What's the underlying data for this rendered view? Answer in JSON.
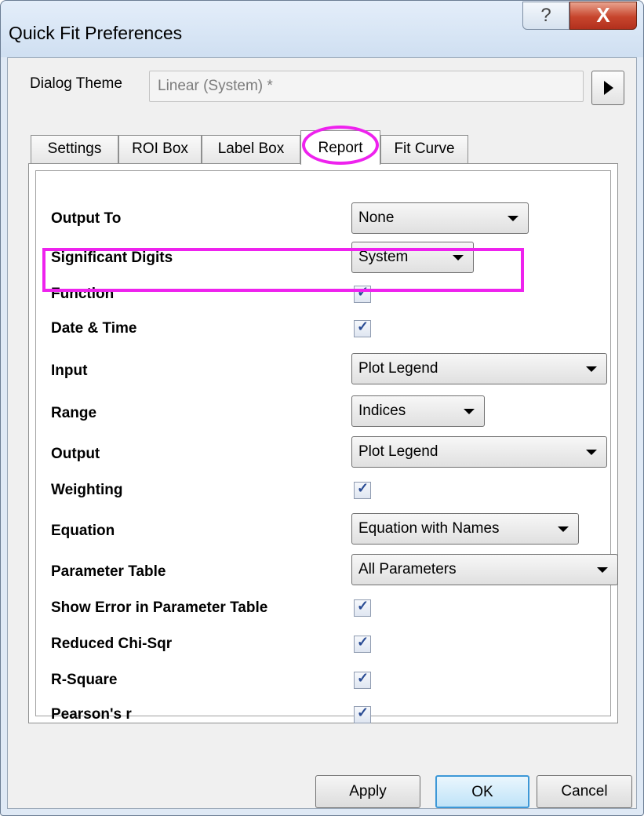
{
  "window": {
    "title": "Quick Fit Preferences",
    "help_glyph": "?",
    "close_glyph": "X"
  },
  "theme": {
    "label": "Dialog Theme",
    "value": "Linear (System) *"
  },
  "tabs": [
    {
      "label": "Settings"
    },
    {
      "label": "ROI Box"
    },
    {
      "label": "Label Box"
    },
    {
      "label": "Report"
    },
    {
      "label": "Fit Curve"
    }
  ],
  "active_tab": "Report",
  "rows": [
    {
      "label": "Output To",
      "control": "combo",
      "value": "None"
    },
    {
      "label": "Significant Digits",
      "control": "combo",
      "value": "System"
    },
    {
      "label": "Function",
      "control": "checkbox",
      "checked": true
    },
    {
      "label": "Date & Time",
      "control": "checkbox",
      "checked": true
    },
    {
      "label": "Input",
      "control": "combo",
      "value": "Plot Legend"
    },
    {
      "label": "Range",
      "control": "combo",
      "value": "Indices"
    },
    {
      "label": "Output",
      "control": "combo",
      "value": "Plot Legend"
    },
    {
      "label": "Weighting",
      "control": "checkbox",
      "checked": true
    },
    {
      "label": "Equation",
      "control": "combo",
      "value": "Equation with Names"
    },
    {
      "label": "Parameter Table",
      "control": "combo",
      "value": "All Parameters"
    },
    {
      "label": "Show Error in Parameter Table",
      "control": "checkbox",
      "checked": true
    },
    {
      "label": "Reduced Chi-Sqr",
      "control": "checkbox",
      "checked": true
    },
    {
      "label": "R-Square",
      "control": "checkbox",
      "checked": true
    },
    {
      "label": "Pearson's r",
      "control": "checkbox",
      "checked": true
    }
  ],
  "buttons": {
    "apply": "Apply",
    "ok": "OK",
    "cancel": "Cancel"
  },
  "colors": {
    "highlight": "#ee22ee",
    "checkmark": "#2a4c94"
  }
}
